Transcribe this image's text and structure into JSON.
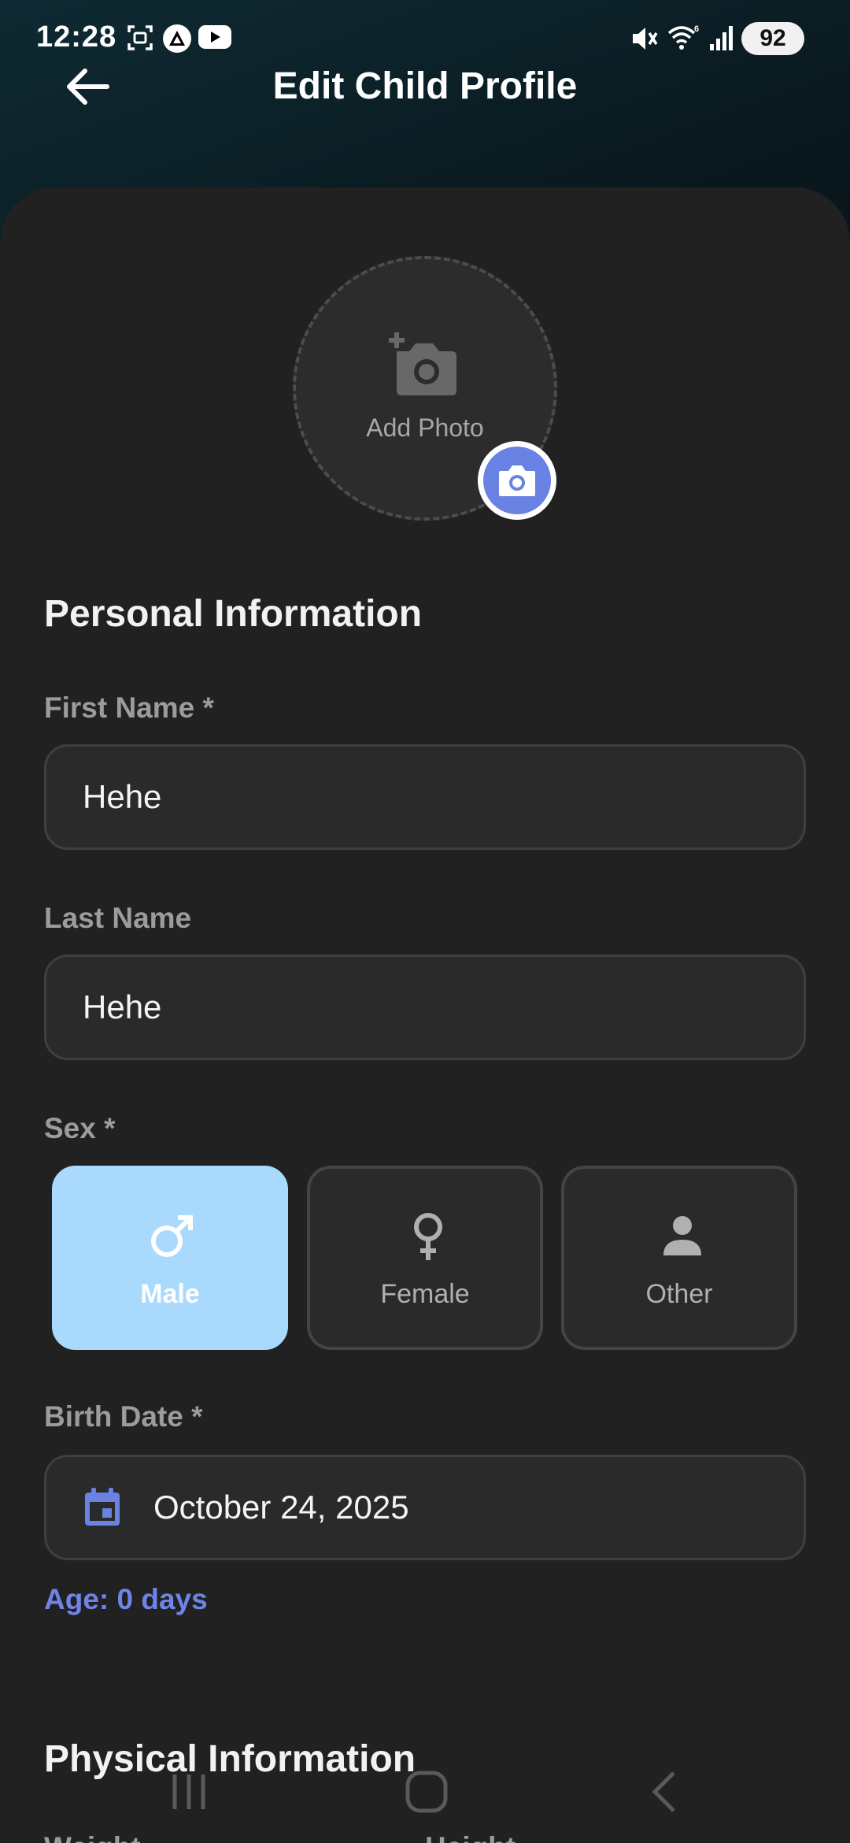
{
  "status_bar": {
    "time": "12:28",
    "battery": "92"
  },
  "header": {
    "title": "Edit Child Profile"
  },
  "photo": {
    "label": "Add Photo"
  },
  "sections": {
    "personal": "Personal Information",
    "physical": "Physical Information"
  },
  "fields": {
    "first_name": {
      "label": "First Name *",
      "value": "Hehe"
    },
    "last_name": {
      "label": "Last Name",
      "value": "Hehe"
    },
    "sex": {
      "label": "Sex *",
      "options": [
        {
          "label": "Male",
          "icon": "male-icon",
          "selected": true
        },
        {
          "label": "Female",
          "icon": "female-icon",
          "selected": false
        },
        {
          "label": "Other",
          "icon": "person-icon",
          "selected": false
        }
      ]
    },
    "birth_date": {
      "label": "Birth Date *",
      "value": "October 24, 2025"
    },
    "age": "Age: 0 days",
    "weight_label": "Weight",
    "height_label": "Height"
  },
  "colors": {
    "accent": "#6a82e4",
    "selected_option": "#a9d9fd",
    "card_bg": "#212121"
  }
}
